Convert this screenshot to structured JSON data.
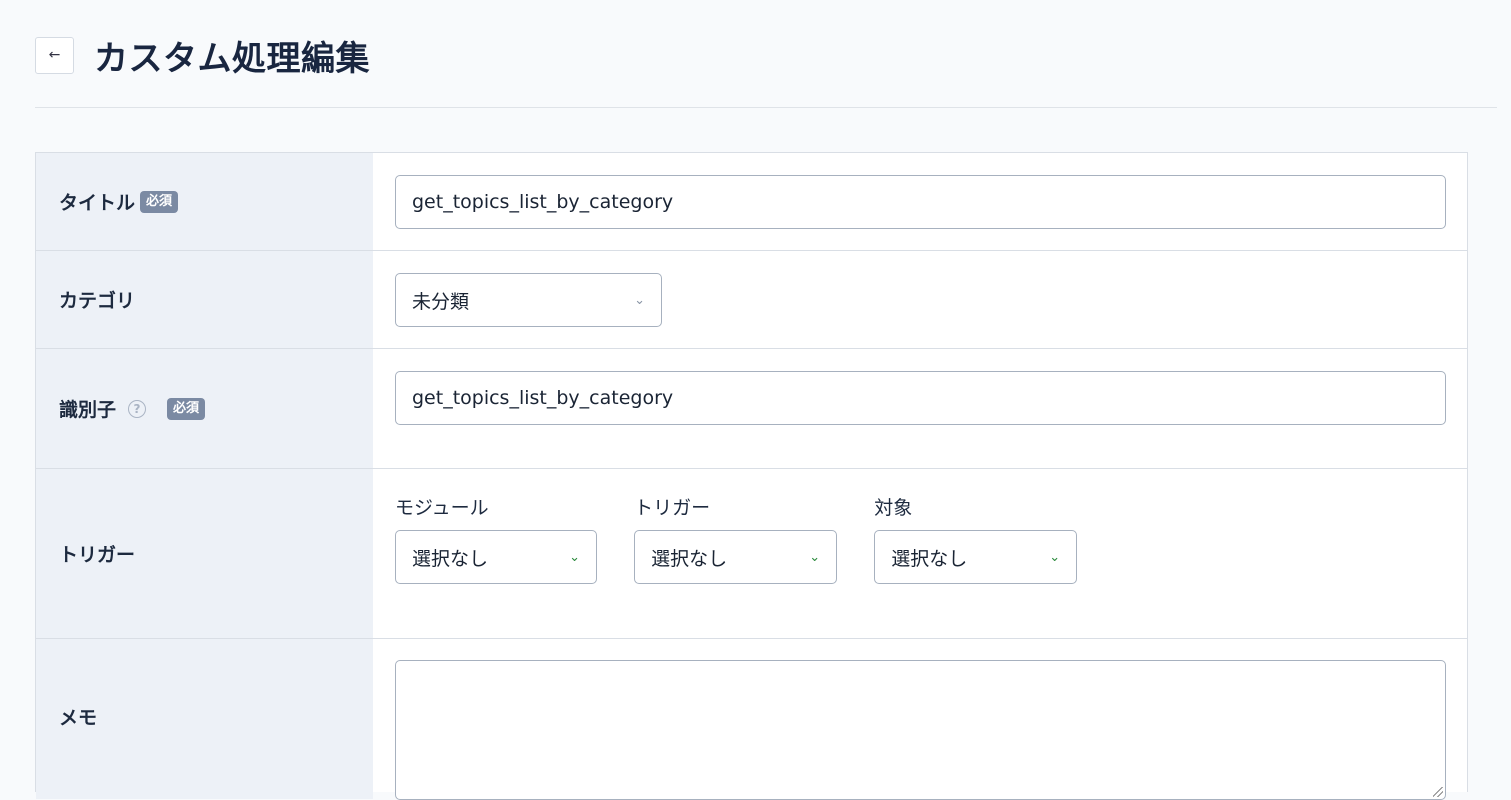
{
  "header": {
    "title": "カスタム処理編集",
    "back_icon": "arrow-left-icon"
  },
  "form": {
    "required_badge": "必須",
    "title_row": {
      "label": "タイトル",
      "value": "get_topics_list_by_category"
    },
    "category_row": {
      "label": "カテゴリ",
      "selected": "未分類"
    },
    "identifier_row": {
      "label": "識別子",
      "value": "get_topics_list_by_category"
    },
    "trigger_row": {
      "label": "トリガー",
      "module": {
        "label": "モジュール",
        "selected": "選択なし"
      },
      "trigger": {
        "label": "トリガー",
        "selected": "選択なし"
      },
      "target": {
        "label": "対象",
        "selected": "選択なし"
      }
    },
    "memo_row": {
      "label": "メモ",
      "value": ""
    }
  }
}
